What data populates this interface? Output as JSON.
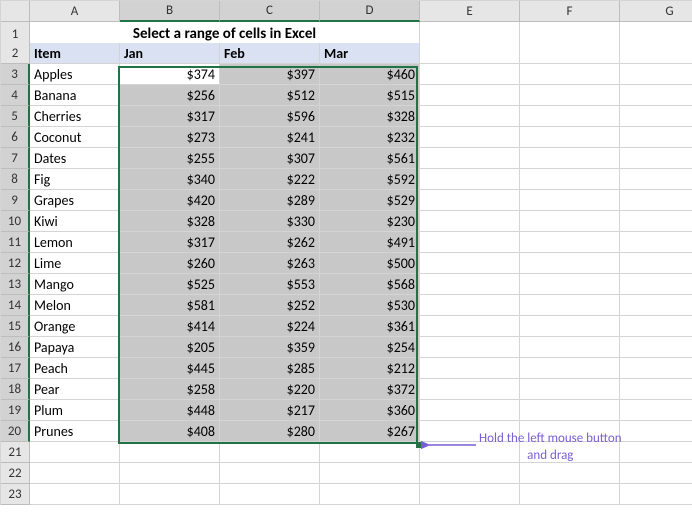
{
  "title": "Select a range of cells in Excel",
  "columns": [
    "A",
    "B",
    "C",
    "D",
    "E",
    "F",
    "G"
  ],
  "rowNumbers": [
    1,
    2,
    3,
    4,
    5,
    6,
    7,
    8,
    9,
    10,
    11,
    12,
    13,
    14,
    15,
    16,
    17,
    18,
    19,
    20,
    21,
    22,
    23
  ],
  "headers": {
    "item": "Item",
    "jan": "Jan",
    "feb": "Feb",
    "mar": "Mar"
  },
  "data": [
    {
      "item": "Apples",
      "jan": "$374",
      "feb": "$397",
      "mar": "$460"
    },
    {
      "item": "Banana",
      "jan": "$256",
      "feb": "$512",
      "mar": "$515"
    },
    {
      "item": "Cherries",
      "jan": "$317",
      "feb": "$596",
      "mar": "$328"
    },
    {
      "item": "Coconut",
      "jan": "$273",
      "feb": "$241",
      "mar": "$232"
    },
    {
      "item": "Dates",
      "jan": "$255",
      "feb": "$307",
      "mar": "$561"
    },
    {
      "item": "Fig",
      "jan": "$340",
      "feb": "$222",
      "mar": "$592"
    },
    {
      "item": "Grapes",
      "jan": "$420",
      "feb": "$289",
      "mar": "$529"
    },
    {
      "item": "Kiwi",
      "jan": "$328",
      "feb": "$330",
      "mar": "$230"
    },
    {
      "item": "Lemon",
      "jan": "$317",
      "feb": "$262",
      "mar": "$491"
    },
    {
      "item": "Lime",
      "jan": "$260",
      "feb": "$263",
      "mar": "$500"
    },
    {
      "item": "Mango",
      "jan": "$525",
      "feb": "$553",
      "mar": "$568"
    },
    {
      "item": "Melon",
      "jan": "$581",
      "feb": "$252",
      "mar": "$530"
    },
    {
      "item": "Orange",
      "jan": "$414",
      "feb": "$224",
      "mar": "$361"
    },
    {
      "item": "Papaya",
      "jan": "$205",
      "feb": "$359",
      "mar": "$254"
    },
    {
      "item": "Peach",
      "jan": "$445",
      "feb": "$285",
      "mar": "$212"
    },
    {
      "item": "Pear",
      "jan": "$258",
      "feb": "$220",
      "mar": "$372"
    },
    {
      "item": "Plum",
      "jan": "$448",
      "feb": "$217",
      "mar": "$360"
    },
    {
      "item": "Prunes",
      "jan": "$408",
      "feb": "$280",
      "mar": "$267"
    }
  ],
  "annotation": {
    "line1": "Hold the left mouse button",
    "line2": "and drag"
  }
}
